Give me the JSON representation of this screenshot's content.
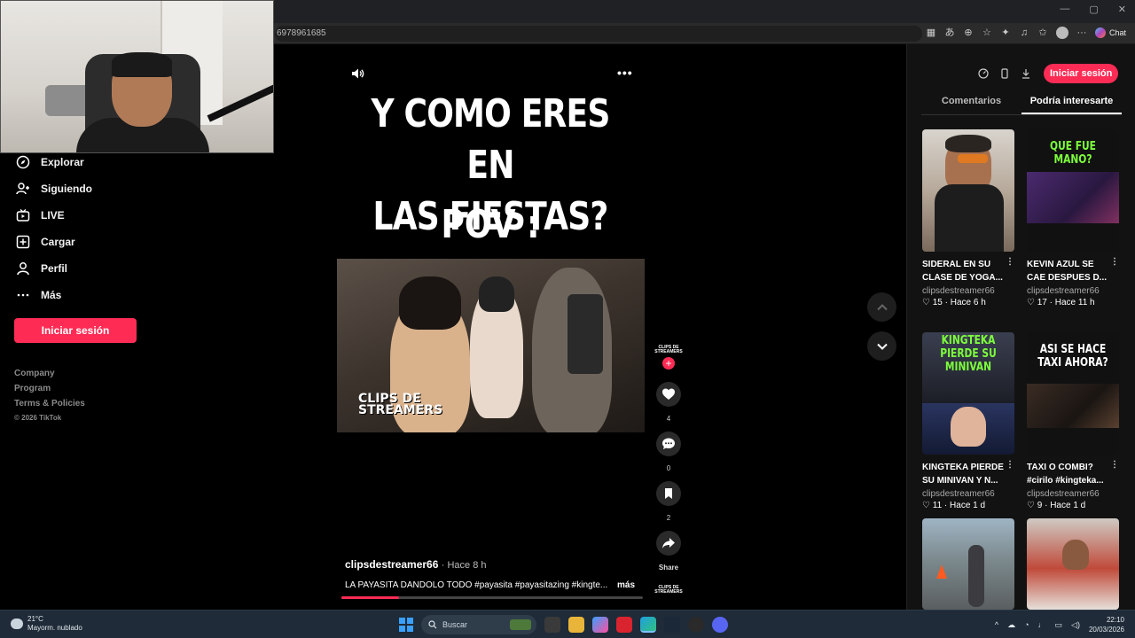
{
  "browser": {
    "url": "6978961685",
    "chat_label": "Chat",
    "win_controls": [
      "—",
      "▢",
      "✕"
    ]
  },
  "sidebar": {
    "items": [
      {
        "label": "Explorar",
        "icon": "compass-icon"
      },
      {
        "label": "Siguiendo",
        "icon": "user-follow-icon"
      },
      {
        "label": "LIVE",
        "icon": "live-tv-icon"
      },
      {
        "label": "Cargar",
        "icon": "upload-plus-icon"
      },
      {
        "label": "Perfil",
        "icon": "profile-icon"
      },
      {
        "label": "Más",
        "icon": "more-dots-icon"
      }
    ],
    "login_label": "Iniciar sesión",
    "footer": [
      "Company",
      "Program",
      "Terms & Policies"
    ],
    "copyright": "© 2026 TikTok"
  },
  "video": {
    "title_line1": "Y COMO ERES EN",
    "title_line2": "LAS FIESTAS?",
    "subtitle": "POV :",
    "watermark_line1": "CLIPS DE",
    "watermark_line2": "STREAMERS",
    "author": "clipsdestreamer66",
    "time": "· Hace 8 h",
    "description": "LA PAYASITA DANDOLO TODO #payasita #payasitazing #kingte...",
    "more_label": "más",
    "progress": 0.19,
    "avatar_text_1": "CLIPS DE",
    "avatar_text_2": "STREAMERS",
    "likes": "4",
    "comments": "0",
    "saves": "2",
    "share_label": "Share",
    "accent": "#fe2c55"
  },
  "right_panel": {
    "login_label": "Iniciar sesión",
    "tabs": [
      "Comentarios",
      "Podría interesarte"
    ],
    "active_tab": 1,
    "cards": [
      {
        "thumb_text": "",
        "title": "SIDERAL EN SU CLASE DE YOGA...",
        "user": "clipsdestreamer66",
        "likes": "15",
        "time": "Hace 6 h"
      },
      {
        "thumb_text": "QUE FUE MANO?",
        "title": "KEVIN AZUL SE CAE DESPUES D...",
        "user": "clipsdestreamer66",
        "likes": "17",
        "time": "Hace 11 h"
      },
      {
        "thumb_text": "KINGTEKA PIERDE SU MINIVAN",
        "title": "KINGTEKA PIERDE SU MINIVAN Y N...",
        "user": "clipsdestreamer66",
        "likes": "11",
        "time": "Hace 1 d"
      },
      {
        "thumb_text": "ASI SE HACE TAXI AHORA?",
        "title": "TAXI O COMBI? #cirilo #kingteka...",
        "user": "clipsdestreamer66",
        "likes": "9",
        "time": "Hace 1 d"
      }
    ]
  },
  "taskbar": {
    "temp": "21°C",
    "weather": "Mayorm. nublado",
    "search_label": "Buscar",
    "time": "22:10",
    "date": "20/03/2026"
  }
}
